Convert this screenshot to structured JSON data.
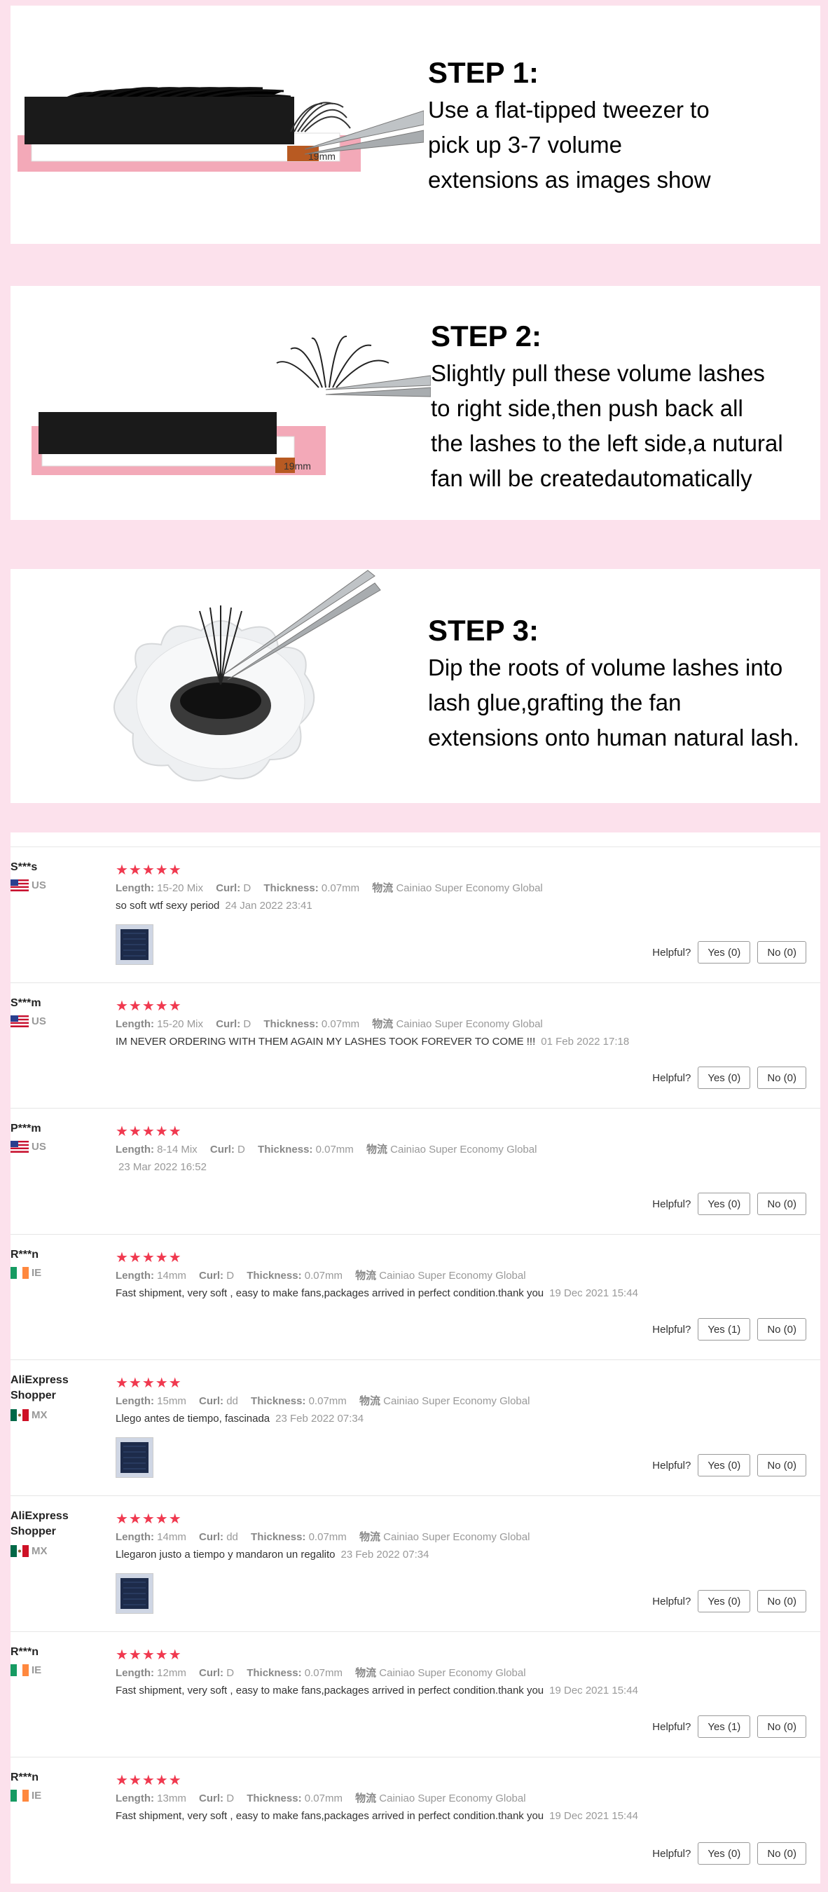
{
  "steps": [
    {
      "title": "STEP 1:",
      "lines": [
        "Use a flat-tipped tweezer to",
        "pick up 3-7 volume",
        "extensions as images show"
      ],
      "size_label": "19mm"
    },
    {
      "title": "STEP 2:",
      "lines": [
        "Slightly pull these volume lashes",
        "to right side,then push back all",
        "the lashes to the left side,a nutural",
        "fan will be createdautomatically"
      ],
      "size_label": "19mm"
    },
    {
      "title": "STEP 3:",
      "lines": [
        "Dip the roots of volume lashes into",
        "lash glue,grafting the fan",
        "extensions onto human natural lash."
      ]
    }
  ],
  "review_labels": {
    "length": "Length:",
    "curl": "Curl:",
    "thickness": "Thickness:",
    "shipping": "物流",
    "helpful": "Helpful?"
  },
  "reviews": [
    {
      "name": "S***s",
      "country": "US",
      "flag": "us",
      "stars": "★★★★★",
      "length": "15-20 Mix",
      "curl": "D",
      "thickness": "0.07mm",
      "shipping": "Cainiao Super Economy Global",
      "comment": "so soft wtf sexy period",
      "date": "24 Jan 2022 23:41",
      "has_photo": true,
      "yes": "Yes (0)",
      "no": "No (0)"
    },
    {
      "name": "S***m",
      "country": "US",
      "flag": "us",
      "stars": "★★★★★",
      "length": "15-20 Mix",
      "curl": "D",
      "thickness": "0.07mm",
      "shipping": "Cainiao Super Economy Global",
      "comment": "IM NEVER ORDERING WITH THEM AGAIN MY LASHES TOOK FOREVER TO COME !!!",
      "date": "01 Feb 2022 17:18",
      "has_photo": false,
      "yes": "Yes (0)",
      "no": "No (0)"
    },
    {
      "name": "P***m",
      "country": "US",
      "flag": "us",
      "stars": "★★★★★",
      "length": "8-14 Mix",
      "curl": "D",
      "thickness": "0.07mm",
      "shipping": "Cainiao Super Economy Global",
      "comment": "",
      "date": "23 Mar 2022 16:52",
      "has_photo": false,
      "yes": "Yes (0)",
      "no": "No (0)"
    },
    {
      "name": "R***n",
      "country": "IE",
      "flag": "ie",
      "stars": "★★★★★",
      "length": "14mm",
      "curl": "D",
      "thickness": "0.07mm",
      "shipping": "Cainiao Super Economy Global",
      "comment": "Fast shipment, very soft , easy to make fans,packages arrived in perfect condition.thank you",
      "date": "19 Dec 2021 15:44",
      "has_photo": false,
      "yes": "Yes (1)",
      "no": "No (0)"
    },
    {
      "name": "AliExpress Shopper",
      "country": "MX",
      "flag": "mx",
      "stars": "★★★★★",
      "length": "15mm",
      "curl": "dd",
      "thickness": "0.07mm",
      "shipping": "Cainiao Super Economy Global",
      "comment": "Llego antes de tiempo, fascinada",
      "date": "23 Feb 2022 07:34",
      "has_photo": true,
      "yes": "Yes (0)",
      "no": "No (0)"
    },
    {
      "name": "AliExpress Shopper",
      "country": "MX",
      "flag": "mx",
      "stars": "★★★★★",
      "length": "14mm",
      "curl": "dd",
      "thickness": "0.07mm",
      "shipping": "Cainiao Super Economy Global",
      "comment": "Llegaron justo a tiempo y mandaron un regalito",
      "date": "23 Feb 2022 07:34",
      "has_photo": true,
      "yes": "Yes (0)",
      "no": "No (0)"
    },
    {
      "name": "R***n",
      "country": "IE",
      "flag": "ie",
      "stars": "★★★★★",
      "length": "12mm",
      "curl": "D",
      "thickness": "0.07mm",
      "shipping": "Cainiao Super Economy Global",
      "comment": "Fast shipment, very soft , easy to make fans,packages arrived in perfect condition.thank you",
      "date": "19 Dec 2021 15:44",
      "has_photo": false,
      "yes": "Yes (1)",
      "no": "No (0)"
    },
    {
      "name": "R***n",
      "country": "IE",
      "flag": "ie",
      "stars": "★★★★★",
      "length": "13mm",
      "curl": "D",
      "thickness": "0.07mm",
      "shipping": "Cainiao Super Economy Global",
      "comment": "Fast shipment, very soft , easy to make fans,packages arrived in perfect condition.thank you",
      "date": "19 Dec 2021 15:44",
      "has_photo": false,
      "yes": "Yes (0)",
      "no": "No (0)"
    }
  ],
  "colors": {
    "page_background": "#fce1ec",
    "stars": "#f0394f",
    "label_pink": "#f3a9b8"
  }
}
